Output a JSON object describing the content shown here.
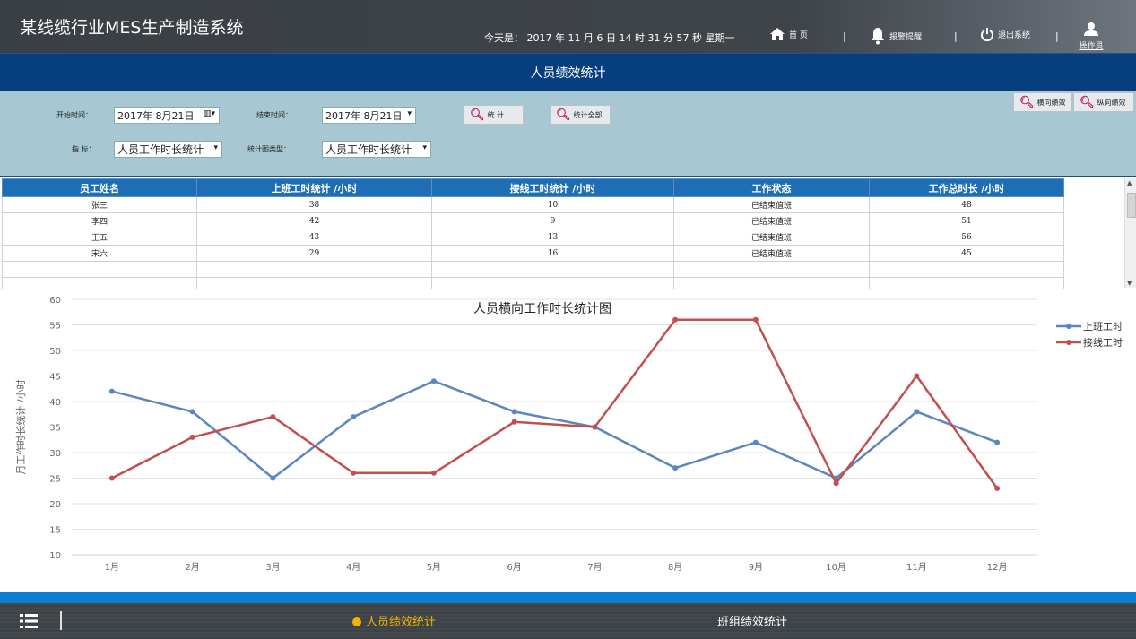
{
  "header": {
    "app_title": "某线缆行业MES生产制造系统",
    "datetime": "今天是： 2017 年 11 月 6 日  14 时 31 分 57 秒    星期一",
    "nav": {
      "home": "首 页",
      "alarm": "报警提醒",
      "logout": "退出系统",
      "operator": "操作员"
    }
  },
  "page": {
    "title": "人员绩效统计"
  },
  "filters": {
    "start_label": "开始时间：",
    "start_value": "2017年  8月21日",
    "end_label": "结束时间：",
    "end_value": "2017年  8月21日",
    "stat_button": "统 计",
    "stat_all_button": "统计全部",
    "indicator_label": "指  标：",
    "indicator_value": "人员工作时长统计",
    "chart_type_label": "统计图类型：",
    "chart_type_value": "人员工作时长统计",
    "horizontal_button": "横向绩效",
    "vertical_button": "纵向绩效"
  },
  "table": {
    "headers": [
      "员工姓名",
      "上班工时统计  /小时",
      "接线工时统计    /小时",
      "工作状态",
      "工作总时长  /小时"
    ],
    "rows": [
      [
        "张三",
        "38",
        "10",
        "已结束值班",
        "48"
      ],
      [
        "李四",
        "42",
        "9",
        "已结束值班",
        "51"
      ],
      [
        "王五",
        "43",
        "13",
        "已结束值班",
        "56"
      ],
      [
        "宋六",
        "29",
        "16",
        "已结束值班",
        "45"
      ],
      [
        "",
        "",
        "",
        "",
        ""
      ],
      [
        "",
        "",
        "",
        "",
        ""
      ]
    ]
  },
  "chart_data": {
    "type": "line",
    "title": "人员横向工作时长统计图",
    "ylabel": "月工作时长统计  /小时",
    "xlabel": "",
    "categories": [
      "1月",
      "2月",
      "3月",
      "4月",
      "5月",
      "6月",
      "7月",
      "8月",
      "9月",
      "10月",
      "11月",
      "12月"
    ],
    "ylim": [
      10,
      60
    ],
    "yticks": [
      10,
      15,
      20,
      25,
      30,
      35,
      40,
      45,
      50,
      55,
      60
    ],
    "grid": true,
    "legend": "top-right",
    "series": [
      {
        "name": "上班工时",
        "color": "#5b86bf",
        "values": [
          42,
          38,
          25,
          37,
          44,
          38,
          35,
          27,
          32,
          25,
          38,
          32
        ]
      },
      {
        "name": "接线工时",
        "color": "#c0504d",
        "values": [
          25,
          33,
          37,
          26,
          26,
          36,
          35,
          56,
          56,
          24,
          45,
          23
        ]
      }
    ]
  },
  "footer": {
    "tabs": [
      "人员绩效统计",
      "班组绩效统计"
    ],
    "active_tab": "人员绩效统计"
  }
}
